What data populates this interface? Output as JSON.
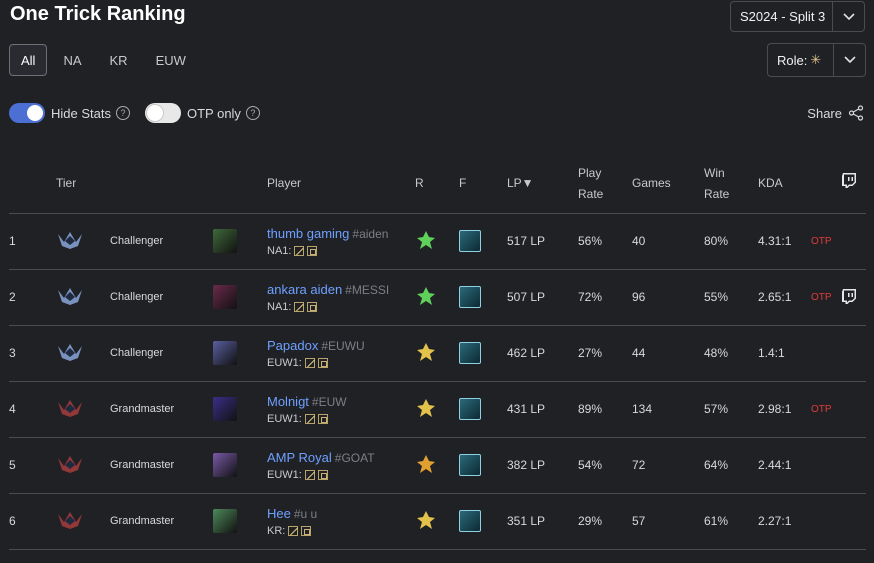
{
  "header": {
    "title": "One Trick Ranking",
    "season": "S2024 - Split 3",
    "role_label": "Role:"
  },
  "regions": [
    "All",
    "NA",
    "KR",
    "EUW"
  ],
  "toggles": {
    "hide_stats": "Hide Stats",
    "otp_only": "OTP only",
    "hide_stats_on": true,
    "otp_only_on": false
  },
  "share": "Share",
  "columns": {
    "tier": "Tier",
    "player": "Player",
    "r": "R",
    "f": "F",
    "lp": "LP▼",
    "play1": "Play",
    "play2": "Rate",
    "games": "Games",
    "win1": "Win",
    "win2": "Rate",
    "kda": "KDA"
  },
  "colors": {
    "accent": "#4b6fd3",
    "link": "#6ea0ff",
    "otp": "#e03c3c",
    "challenger": "#8aa4d8",
    "grandmaster": "#a83c3c"
  },
  "rows": [
    {
      "rank": "1",
      "tier": "Challenger",
      "tier_icon": "challenger-emblem-icon",
      "champ_color": "#3f6a3a",
      "name": "thumb gaming",
      "tag": "#aiden",
      "server": "NA1:",
      "rune": "green-rune-icon",
      "lp": "517 LP",
      "play_rate": "56%",
      "games": "40",
      "win_rate": "80%",
      "kda": "4.31:1",
      "otp": "OTP",
      "twitch": false
    },
    {
      "rank": "2",
      "tier": "Challenger",
      "tier_icon": "challenger-emblem-icon",
      "champ_color": "#6a2a4a",
      "name": "ankara aiden",
      "tag": "#MESSI",
      "server": "NA1:",
      "rune": "green-rune-icon",
      "lp": "507 LP",
      "play_rate": "72%",
      "games": "96",
      "win_rate": "55%",
      "kda": "2.65:1",
      "otp": "OTP",
      "twitch": true
    },
    {
      "rank": "3",
      "tier": "Challenger",
      "tier_icon": "challenger-emblem-icon",
      "champ_color": "#5a5fa0",
      "name": "Papadox",
      "tag": "#EUWU",
      "server": "EUW1:",
      "rune": "gold-rune-icon",
      "lp": "462 LP",
      "play_rate": "27%",
      "games": "44",
      "win_rate": "48%",
      "kda": "1.4:1",
      "otp": "",
      "twitch": false
    },
    {
      "rank": "4",
      "tier": "Grandmaster",
      "tier_icon": "grandmaster-emblem-icon",
      "champ_color": "#3a2f8a",
      "name": "Molnigt",
      "tag": "#EUW",
      "server": "EUW1:",
      "rune": "gold-rune-icon",
      "lp": "431 LP",
      "play_rate": "89%",
      "games": "134",
      "win_rate": "57%",
      "kda": "2.98:1",
      "otp": "OTP",
      "twitch": false
    },
    {
      "rank": "5",
      "tier": "Grandmaster",
      "tier_icon": "grandmaster-emblem-icon",
      "champ_color": "#7a5aa8",
      "name": "AMP Royal",
      "tag": "#GOAT",
      "server": "EUW1:",
      "rune": "orange-rune-icon",
      "lp": "382 LP",
      "play_rate": "54%",
      "games": "72",
      "win_rate": "64%",
      "kda": "2.44:1",
      "otp": "",
      "twitch": false
    },
    {
      "rank": "6",
      "tier": "Grandmaster",
      "tier_icon": "grandmaster-emblem-icon",
      "champ_color": "#4d8a5a",
      "name": "Hee",
      "tag": "#u u",
      "server": "KR:",
      "rune": "gold-rune-icon",
      "lp": "351 LP",
      "play_rate": "29%",
      "games": "57",
      "win_rate": "61%",
      "kda": "2.27:1",
      "otp": "",
      "twitch": false
    }
  ]
}
